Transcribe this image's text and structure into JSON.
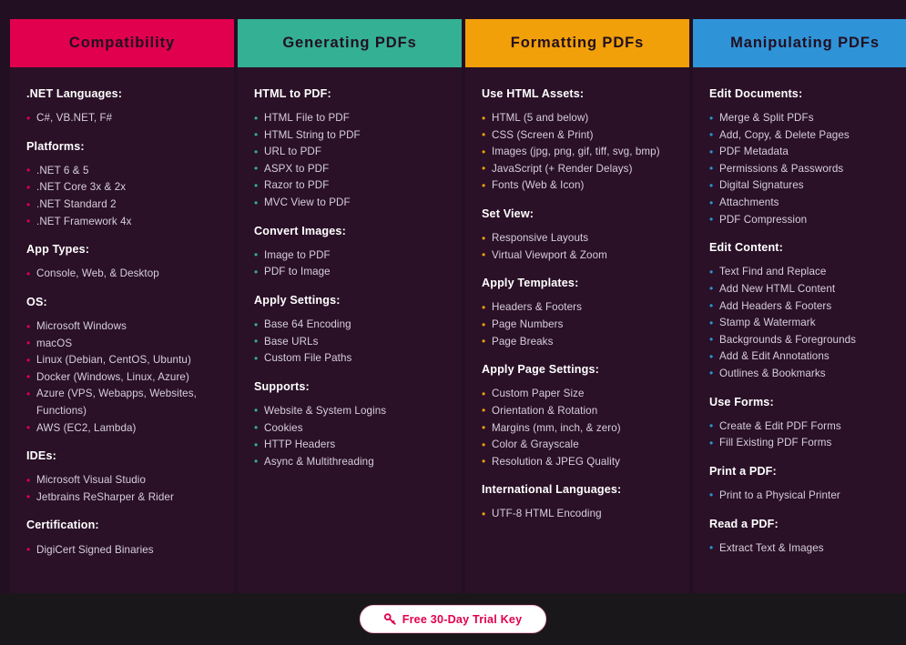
{
  "theme": {
    "page_background": "#230f22",
    "card_background": "#2a1127",
    "footer_background": "#1a171a",
    "heading_text_color": "#ffffff",
    "item_text_color": "#d7cedd",
    "header_text_color": "#221020"
  },
  "columns": [
    {
      "title": "Compatibility",
      "accent": "#e1004e",
      "groups": [
        {
          "title": ".NET Languages:",
          "items": [
            "C#, VB.NET, F#"
          ]
        },
        {
          "title": "Platforms:",
          "items": [
            ".NET 6 & 5",
            ".NET Core 3x & 2x",
            ".NET Standard 2",
            ".NET Framework 4x"
          ]
        },
        {
          "title": "App Types:",
          "items": [
            "Console, Web, & Desktop"
          ]
        },
        {
          "title": "OS:",
          "items": [
            "Microsoft Windows",
            "macOS",
            "Linux (Debian, CentOS, Ubuntu)",
            "Docker (Windows, Linux, Azure)",
            "Azure (VPS, Webapps, Websites, Functions)",
            "AWS (EC2, Lambda)"
          ]
        },
        {
          "title": "IDEs:",
          "items": [
            "Microsoft Visual Studio",
            "Jetbrains ReSharper & Rider"
          ]
        },
        {
          "title": "Certification:",
          "items": [
            "DigiCert Signed Binaries"
          ]
        }
      ]
    },
    {
      "title": "Generating PDFs",
      "accent": "#34b094",
      "groups": [
        {
          "title": "HTML to PDF:",
          "items": [
            "HTML File to PDF",
            "HTML String to PDF",
            "URL to PDF",
            "ASPX to PDF",
            "Razor to PDF",
            "MVC View to PDF"
          ]
        },
        {
          "title": "Convert Images:",
          "items": [
            "Image to PDF",
            "PDF to Image"
          ]
        },
        {
          "title": "Apply Settings:",
          "items": [
            "Base 64 Encoding",
            "Base URLs",
            "Custom File Paths"
          ]
        },
        {
          "title": "Supports:",
          "items": [
            "Website & System Logins",
            "Cookies",
            "HTTP Headers",
            "Async & Multithreading"
          ]
        }
      ]
    },
    {
      "title": "Formatting PDFs",
      "accent": "#f2a009",
      "groups": [
        {
          "title": "Use HTML Assets:",
          "items": [
            "HTML (5 and below)",
            "CSS (Screen & Print)",
            "Images (jpg, png, gif, tiff, svg, bmp)",
            "JavaScript (+ Render Delays)",
            "Fonts (Web & Icon)"
          ]
        },
        {
          "title": "Set View:",
          "items": [
            "Responsive Layouts",
            "Virtual Viewport & Zoom"
          ]
        },
        {
          "title": "Apply Templates:",
          "items": [
            "Headers & Footers",
            "Page Numbers",
            "Page Breaks"
          ]
        },
        {
          "title": "Apply Page Settings:",
          "items": [
            "Custom Paper Size",
            "Orientation & Rotation",
            "Margins (mm, inch, & zero)",
            "Color & Grayscale",
            "Resolution & JPEG Quality"
          ]
        },
        {
          "title": "International Languages:",
          "items": [
            "UTF-8 HTML Encoding"
          ]
        }
      ]
    },
    {
      "title": "Manipulating PDFs",
      "accent": "#2f93d8",
      "groups": [
        {
          "title": "Edit Documents:",
          "items": [
            "Merge & Split PDFs",
            "Add, Copy, & Delete Pages",
            "PDF Metadata",
            "Permissions & Passwords",
            "Digital Signatures",
            "Attachments",
            "PDF Compression"
          ]
        },
        {
          "title": "Edit Content:",
          "items": [
            "Text Find and Replace",
            "Add New HTML Content",
            "Add Headers & Footers",
            "Stamp & Watermark",
            "Backgrounds & Foregrounds",
            "Add & Edit Annotations",
            "Outlines & Bookmarks"
          ]
        },
        {
          "title": "Use Forms:",
          "items": [
            "Create & Edit PDF Forms",
            "Fill Existing PDF Forms"
          ]
        },
        {
          "title": "Print a PDF:",
          "items": [
            "Print to a Physical Printer"
          ]
        },
        {
          "title": "Read a PDF:",
          "items": [
            "Extract Text & Images"
          ]
        }
      ]
    }
  ],
  "footer": {
    "trial_button": {
      "label": "Free 30-Day Trial Key",
      "icon": "key-icon",
      "text_color": "#e1004e",
      "background": "#ffffff"
    }
  }
}
